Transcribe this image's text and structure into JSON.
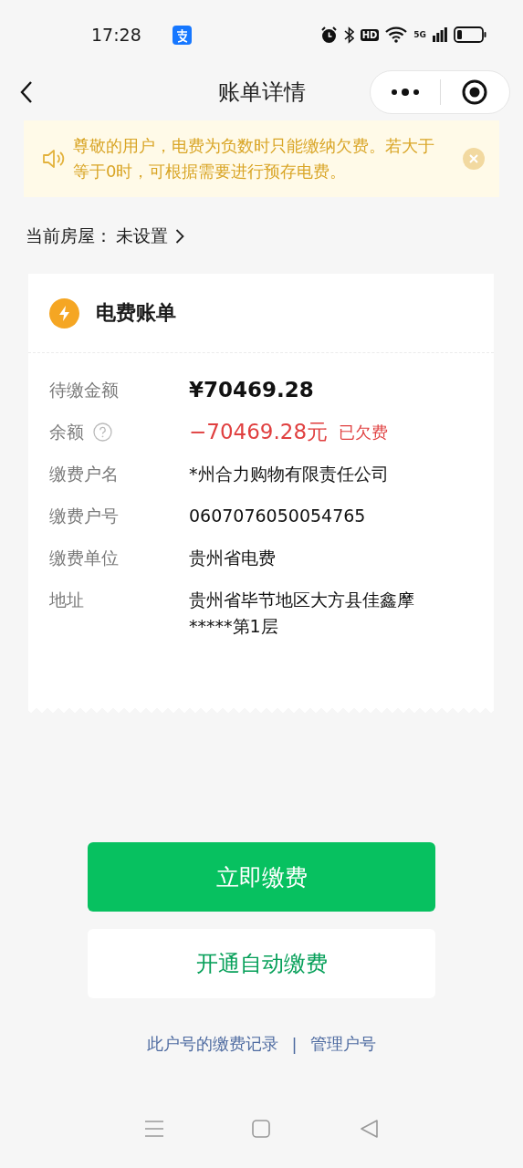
{
  "status_bar": {
    "time": "17:28",
    "hd": "HD",
    "network": "5G"
  },
  "nav": {
    "title": "账单详情"
  },
  "notice": {
    "text": "尊敬的用户，电费为负数时只能缴纳欠费。若大于等于0时，可根据需要进行预存电费。"
  },
  "house": {
    "label": "当前房屋：",
    "value": "未设置"
  },
  "bill": {
    "title": "电费账单",
    "rows": [
      {
        "kind": "amount",
        "label": "待缴金额",
        "value": "¥70469.28"
      },
      {
        "kind": "balance",
        "label": "余额",
        "value": "−70469.28元",
        "tag": "已欠费"
      },
      {
        "kind": "text",
        "label": "缴费户名",
        "value": "*州合力购物有限责任公司"
      },
      {
        "kind": "text",
        "label": "缴费户号",
        "value": "0607076050054765"
      },
      {
        "kind": "text",
        "label": "缴费单位",
        "value": "贵州省电费"
      },
      {
        "kind": "text",
        "label": "地址",
        "value": "贵州省毕节地区大方县佳鑫摩*****第1层"
      }
    ]
  },
  "buttons": [
    {
      "kind": "primary",
      "label": "立即缴费"
    },
    {
      "kind": "secondary",
      "label": "开通自动缴费"
    }
  ],
  "links": [
    "此户号的缴费记录",
    "管理户号"
  ],
  "link_separator": "|"
}
